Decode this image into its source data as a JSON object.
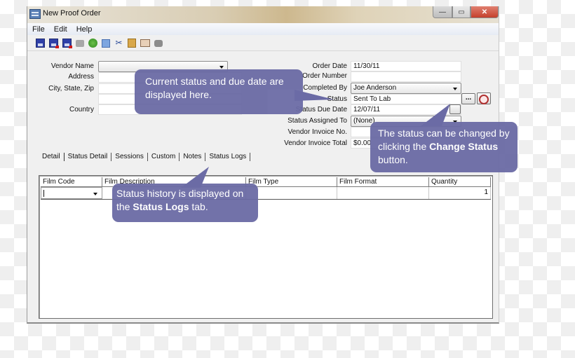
{
  "window": {
    "title": "New Proof Order",
    "controls": {
      "minimize": "—",
      "maximize": "▭",
      "close": "✕"
    }
  },
  "menubar": {
    "items": [
      "File",
      "Edit",
      "Help"
    ]
  },
  "toolbar": {
    "icons": [
      "save-icon",
      "save-and-new-icon",
      "save-and-delete-icon",
      "print-icon",
      "refresh-icon",
      "copy-icon",
      "cut-icon",
      "paste-icon",
      "contact-card-icon",
      "camera-icon"
    ]
  },
  "form_left": {
    "vendor_name": {
      "label": "Vendor Name",
      "value": ""
    },
    "address": {
      "label": "Address",
      "value": ""
    },
    "city_state_zip": {
      "label": "City, State, Zip",
      "value": ""
    },
    "country": {
      "label": "Country",
      "value": ""
    }
  },
  "form_right": {
    "order_date": {
      "label": "Order Date",
      "value": "11/30/11"
    },
    "order_number": {
      "label": "Order Number",
      "value": ""
    },
    "completed_by": {
      "label": "Completed By",
      "value": "Joe Anderson"
    },
    "status": {
      "label": "Status",
      "value": "Sent To Lab",
      "change_button": "..."
    },
    "status_due_date": {
      "label": "Status Due Date",
      "value": "12/07/11"
    },
    "status_assigned_to": {
      "label": "Status Assigned To",
      "value": "(None)"
    },
    "vendor_invoice_no": {
      "label": "Vendor Invoice No.",
      "value": ""
    },
    "vendor_invoice_total": {
      "label": "Vendor Invoice Total",
      "value": "$0.00"
    }
  },
  "tabs": [
    "Detail",
    "Status Detail",
    "Sessions",
    "Custom",
    "Notes",
    "Status Logs"
  ],
  "grid": {
    "columns": [
      "Film Code",
      "Film Description",
      "Film Type",
      "Film Format",
      "Quantity"
    ],
    "rows": [
      [
        "",
        "",
        "",
        "",
        "1"
      ]
    ]
  },
  "callouts": {
    "current_status": "Current status and due date are displayed here.",
    "change_status_pre": "The status can be changed by clicking the ",
    "change_status_bold": "Change Status",
    "change_status_post": " button.",
    "status_history_pre": "Status history is displayed on the ",
    "status_history_bold": "Status Logs",
    "status_history_post": " tab."
  }
}
